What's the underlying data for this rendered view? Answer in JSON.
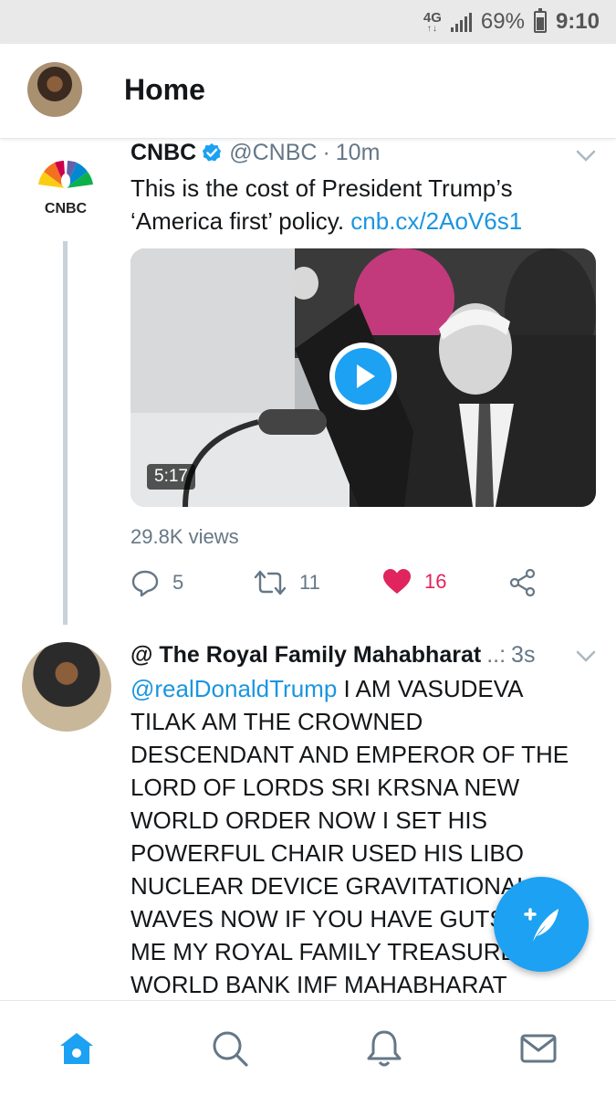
{
  "status_bar": {
    "network": "4G",
    "battery_percent": "69%",
    "battery_level": 0.69,
    "time": "9:10"
  },
  "header": {
    "title": "Home"
  },
  "tweets": [
    {
      "display_name": "CNBC",
      "verified": true,
      "screen_name": "@CNBC",
      "separator": "·",
      "time": "10m",
      "text": "This is the cost of President Trump’s ‘America first’ policy.",
      "link": "cnb.cx/2AoV6s1",
      "media": {
        "type": "video",
        "duration": "5:17"
      },
      "views": "29.8K views",
      "replies": "5",
      "retweets": "11",
      "likes": "16",
      "liked": true
    },
    {
      "display_name": "@ The Royal Family Mahabharat",
      "truncation": "..:",
      "time": "3s",
      "mention": "@realDonaldTrump",
      "lines": [
        " I AM VASUDEVA",
        "TILAK AM THE CROWNED",
        "DESCENDANT AND EMPEROR OF THE",
        "LORD OF LORDS SRI KRSNA NEW",
        "WORLD ORDER NOW I SET HIS",
        "POWERFUL CHAIR USED HIS LIBO",
        "NUCLEAR DEVICE GRAVITATIONAL",
        "WAVES NOW IF YOU HAVE GUTS",
        "ME MY ROYAL FAMILY TREASURE",
        "WORLD BANK IMF MAHABHARAT"
      ]
    }
  ],
  "colors": {
    "accent": "#1da1f2",
    "link": "#1b95e0",
    "like": "#e0245e",
    "muted": "#657786"
  },
  "nav": {
    "items": [
      "home-icon",
      "search-icon",
      "notifications-icon",
      "messages-icon"
    ],
    "active": "home-icon"
  }
}
